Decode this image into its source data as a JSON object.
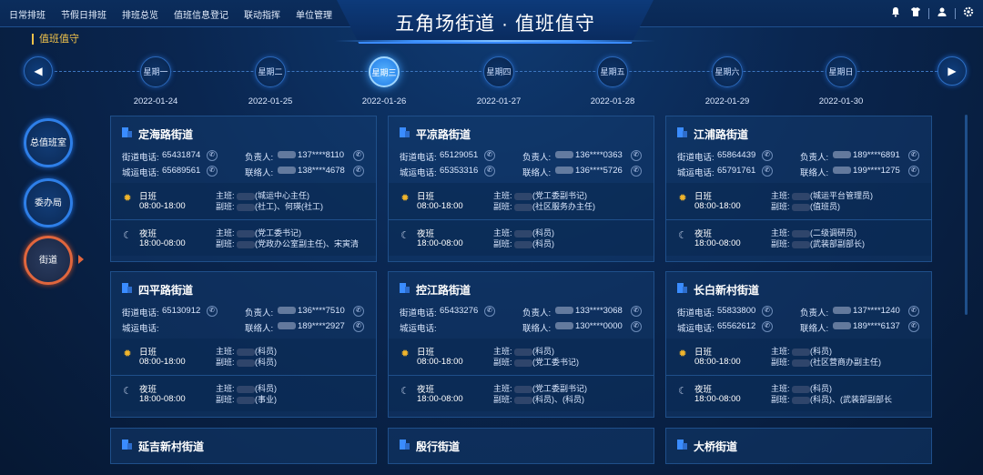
{
  "nav": [
    "日常排班",
    "节假日排班",
    "排班总览",
    "值班信息登记",
    "联动指挥",
    "单位管理"
  ],
  "title": "五角场街道 · 值班值守",
  "topicons": [
    "bell-icon",
    "shirt-icon",
    "user-icon",
    "settings-icon"
  ],
  "section_label": "值班值守",
  "timeline": {
    "days": [
      {
        "label": "星期一",
        "date": "2022-01-24"
      },
      {
        "label": "星期二",
        "date": "2022-01-25"
      },
      {
        "label": "星期三",
        "date": "2022-01-26"
      },
      {
        "label": "星期四",
        "date": "2022-01-27"
      },
      {
        "label": "星期五",
        "date": "2022-01-28"
      },
      {
        "label": "星期六",
        "date": "2022-01-29"
      },
      {
        "label": "星期日",
        "date": "2022-01-30"
      }
    ],
    "active_index": 2
  },
  "side": [
    "总值班室",
    "委办局",
    "街道"
  ],
  "colors": {
    "accent": "#2e7fe8",
    "active_side": "#e0663d",
    "section": "#f0c24a"
  },
  "cards": [
    {
      "name": "定海路街道",
      "street_phone_label": "街道电话:",
      "street_phone": "65431874",
      "city_phone_label": "城运电话:",
      "city_phone": "65689561",
      "leader_label": "负责人:",
      "leader_phone": "137****8110",
      "contact_label": "联络人:",
      "contact_phone": "138****4678",
      "day": {
        "name": "日班",
        "time": "08:00-18:00",
        "main": "主班:",
        "main_text": "(城运中心主任)",
        "vice": "副班:",
        "vice_text": "(社工)、何瑛(社工)"
      },
      "night": {
        "name": "夜班",
        "time": "18:00-08:00",
        "main": "主班:",
        "main_text": "(党工委书记)",
        "vice": "副班:",
        "vice_text": "(党政办公室副主任)、宋寅清"
      }
    },
    {
      "name": "平凉路街道",
      "street_phone_label": "街道电话:",
      "street_phone": "65129051",
      "city_phone_label": "城运电话:",
      "city_phone": "65353316",
      "leader_label": "负责人:",
      "leader_phone": "136****0363",
      "contact_label": "联络人:",
      "contact_phone": "136****5726",
      "day": {
        "name": "日班",
        "time": "08:00-18:00",
        "main": "主班:",
        "main_text": "(党工委副书记)",
        "vice": "副班:",
        "vice_text": "(社区服务办主任)"
      },
      "night": {
        "name": "夜班",
        "time": "18:00-08:00",
        "main": "主班:",
        "main_text": "(科员)",
        "vice": "副班:",
        "vice_text": "(科员)"
      }
    },
    {
      "name": "江浦路街道",
      "street_phone_label": "街道电话:",
      "street_phone": "65864439",
      "city_phone_label": "城运电话:",
      "city_phone": "65791761",
      "leader_label": "负责人:",
      "leader_phone": "189****6891",
      "contact_label": "联络人:",
      "contact_phone": "199****1275",
      "day": {
        "name": "日班",
        "time": "08:00-18:00",
        "main": "主班:",
        "main_text": "(城运平台管理员)",
        "vice": "副班:",
        "vice_text": "(值班员)"
      },
      "night": {
        "name": "夜班",
        "time": "18:00-08:00",
        "main": "主班:",
        "main_text": "(二级调研员)",
        "vice": "副班:",
        "vice_text": "(武装部副部长)"
      }
    },
    {
      "name": "四平路街道",
      "street_phone_label": "街道电话:",
      "street_phone": "65130912",
      "city_phone_label": "城运电话:",
      "city_phone": "",
      "leader_label": "负责人:",
      "leader_phone": "136****7510",
      "contact_label": "联络人:",
      "contact_phone": "189****2927",
      "day": {
        "name": "日班",
        "time": "08:00-18:00",
        "main": "主班:",
        "main_text": "(科员)",
        "vice": "副班:",
        "vice_text": "(科员)"
      },
      "night": {
        "name": "夜班",
        "time": "18:00-08:00",
        "main": "主班:",
        "main_text": "(科员)",
        "vice": "副班:",
        "vice_text": "(事业)"
      }
    },
    {
      "name": "控江路街道",
      "street_phone_label": "街道电话:",
      "street_phone": "65433276",
      "city_phone_label": "城运电话:",
      "city_phone": "",
      "leader_label": "负责人:",
      "leader_phone": "133****3068",
      "contact_label": "联络人:",
      "contact_phone": "130****0000",
      "day": {
        "name": "日班",
        "time": "08:00-18:00",
        "main": "主班:",
        "main_text": "(科员)",
        "vice": "副班:",
        "vice_text": "(党工委书记)"
      },
      "night": {
        "name": "夜班",
        "time": "18:00-08:00",
        "main": "主班:",
        "main_text": "(党工委副书记)",
        "vice": "副班:",
        "vice_text": "(科员)、(科员)"
      }
    },
    {
      "name": "长白新村街道",
      "street_phone_label": "街道电话:",
      "street_phone": "55833800",
      "city_phone_label": "城运电话:",
      "city_phone": "65562612",
      "leader_label": "负责人:",
      "leader_phone": "137****1240",
      "contact_label": "联络人:",
      "contact_phone": "189****6137",
      "day": {
        "name": "日班",
        "time": "08:00-18:00",
        "main": "主班:",
        "main_text": "(科员)",
        "vice": "副班:",
        "vice_text": "(社区营商办副主任)"
      },
      "night": {
        "name": "夜班",
        "time": "18:00-08:00",
        "main": "主班:",
        "main_text": "(科员)",
        "vice": "副班:",
        "vice_text": "(科员)、(武装部副部长"
      }
    },
    {
      "name": "延吉新村街道"
    },
    {
      "name": "殷行街道"
    },
    {
      "name": "大桥街道"
    }
  ]
}
